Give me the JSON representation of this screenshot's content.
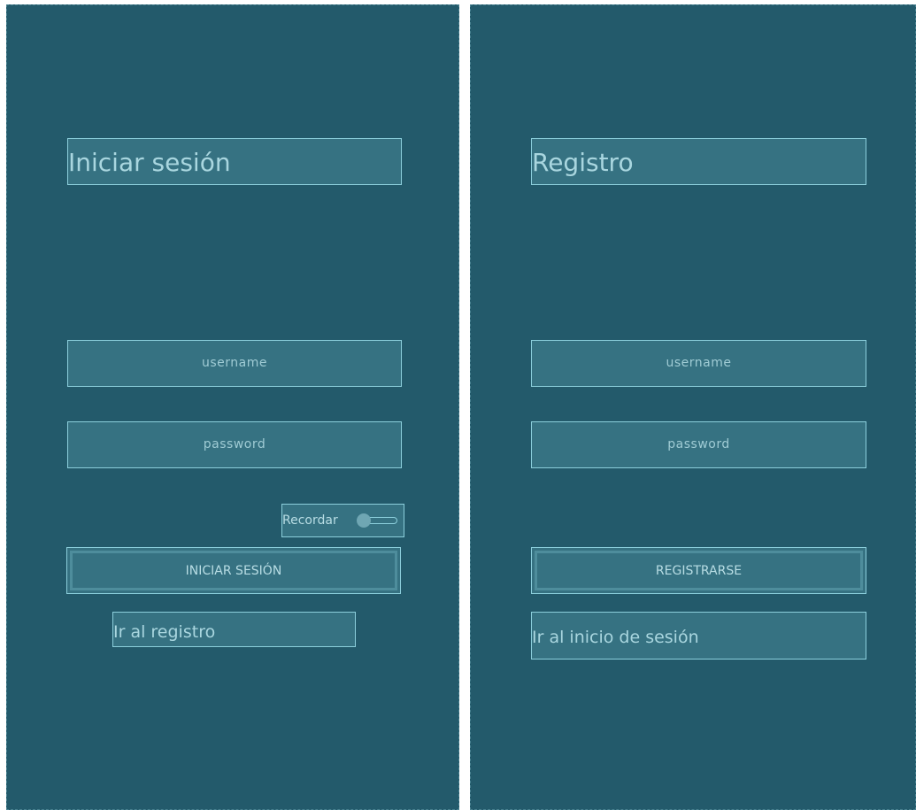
{
  "login": {
    "title": "Iniciar sesión",
    "username_placeholder": "username",
    "password_placeholder": "password",
    "remember_label": "Recordar",
    "remember_on": false,
    "submit_label": "INICIAR SESIÓN",
    "switch_link": "Ir al registro"
  },
  "register": {
    "title": "Registro",
    "username_placeholder": "username",
    "password_placeholder": "password",
    "submit_label": "REGISTRARSE",
    "switch_link": "Ir al inicio de sesión"
  },
  "colors": {
    "panel_background": "#235a6b",
    "control_background": "#367282",
    "control_border": "#8ccfdc",
    "text": "#b8dde4"
  }
}
